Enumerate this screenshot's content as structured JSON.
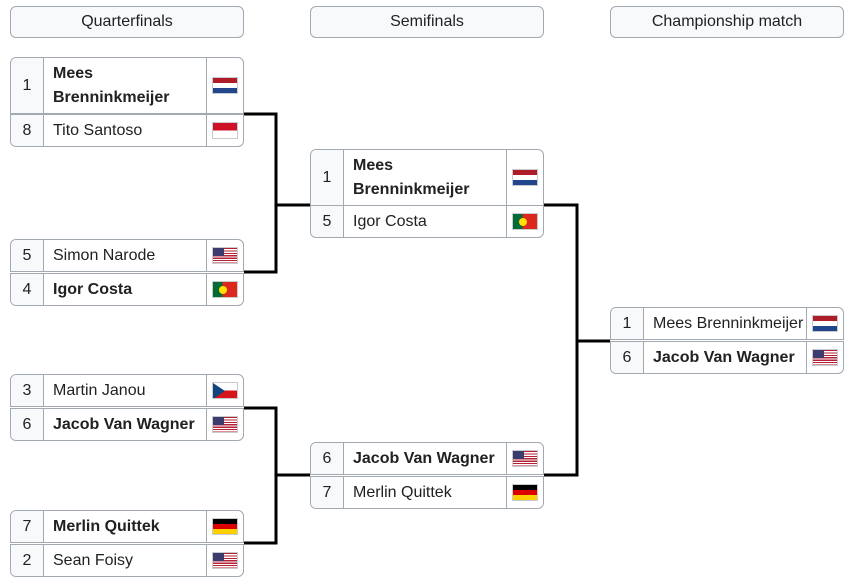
{
  "rounds": [
    "Quarterfinals",
    "Semifinals",
    "Championship match"
  ],
  "quarterfinals": [
    [
      {
        "seed": "1",
        "name": "Mees Brenninkmeijer",
        "flag": "NED",
        "winner": true
      },
      {
        "seed": "8",
        "name": "Tito Santoso",
        "flag": "INA",
        "winner": false
      }
    ],
    [
      {
        "seed": "5",
        "name": "Simon Narode",
        "flag": "USA",
        "winner": false
      },
      {
        "seed": "4",
        "name": "Igor Costa",
        "flag": "POR",
        "winner": true
      }
    ],
    [
      {
        "seed": "3",
        "name": "Martin Janou",
        "flag": "CZE",
        "winner": false
      },
      {
        "seed": "6",
        "name": "Jacob Van Wagner",
        "flag": "USA",
        "winner": true
      }
    ],
    [
      {
        "seed": "7",
        "name": "Merlin Quittek",
        "flag": "GER",
        "winner": true
      },
      {
        "seed": "2",
        "name": "Sean Foisy",
        "flag": "USA",
        "winner": false
      }
    ]
  ],
  "semifinals": [
    [
      {
        "seed": "1",
        "name": "Mees Brenninkmeijer",
        "flag": "NED",
        "winner": true
      },
      {
        "seed": "5",
        "name": "Igor Costa",
        "flag": "POR",
        "winner": false
      }
    ],
    [
      {
        "seed": "6",
        "name": "Jacob Van Wagner",
        "flag": "USA",
        "winner": true
      },
      {
        "seed": "7",
        "name": "Merlin Quittek",
        "flag": "GER",
        "winner": false
      }
    ]
  ],
  "championship": [
    [
      {
        "seed": "1",
        "name": "Mees Brenninkmeijer",
        "flag": "NED",
        "winner": false
      },
      {
        "seed": "6",
        "name": "Jacob Van Wagner",
        "flag": "USA",
        "winner": true
      }
    ]
  ]
}
